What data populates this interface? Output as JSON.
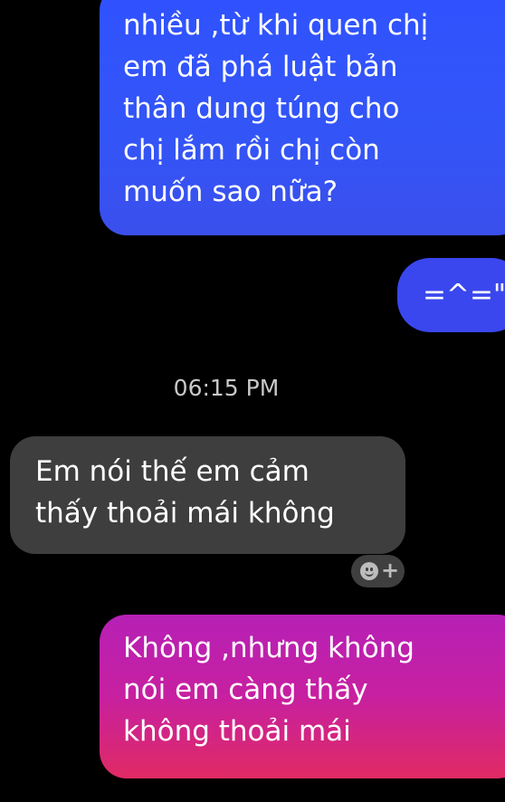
{
  "messages": [
    {
      "id": "msg-1",
      "direction": "outgoing",
      "lines": [
        "nhiều ,từ khi quen chị",
        "em đã phá luật bản",
        "thân dung túng cho",
        "chị lắm rồi chị còn",
        "muốn sao nữa?"
      ]
    },
    {
      "id": "msg-2",
      "direction": "outgoing",
      "lines": [
        "=^=\""
      ]
    },
    {
      "id": "msg-3",
      "direction": "incoming",
      "lines": [
        "Em nói thế em cảm",
        "thấy thoải mái không"
      ]
    },
    {
      "id": "msg-4",
      "direction": "outgoing",
      "lines": [
        "Không ,nhưng không",
        "nói em càng thấy",
        "không thoải mái"
      ]
    }
  ],
  "timestamp": "06:15 PM",
  "react_button": {
    "icon": "add-reaction-icon",
    "plus_glyph": "+"
  },
  "colors": {
    "background": "#000000",
    "outgoing_blue": "#3355f7",
    "outgoing_pink": "#c720a0",
    "incoming_gray": "#3e3e3e",
    "timestamp_text": "#c8c8c8"
  }
}
